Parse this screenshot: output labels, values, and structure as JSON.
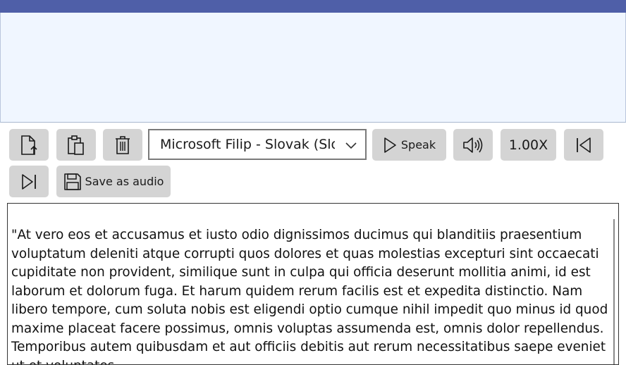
{
  "window": {
    "titlebar_color": "#4f5fa8",
    "panel_color": "#f0f6ff"
  },
  "toolbar": {
    "open_icon": "open-file-icon",
    "paste_icon": "paste-icon",
    "clear_icon": "trash-icon",
    "voice_selected": "Microsoft Filip - Slovak (Slovakia)",
    "speak_label": "Speak",
    "volume_icon": "volume-icon",
    "rate_label": "1.00X",
    "previous_icon": "skip-back-icon",
    "next_icon": "skip-forward-icon",
    "save_audio_label": "Save as audio"
  },
  "editor": {
    "text": "\"At vero eos et accusamus et iusto odio dignissimos ducimus qui blanditiis praesentium voluptatum deleniti atque corrupti quos dolores et quas molestias excepturi sint occaecati cupiditate non provident, similique sunt in culpa qui officia deserunt mollitia animi, id est laborum et dolorum fuga. Et harum quidem rerum facilis est et expedita distinctio. Nam libero tempore, cum soluta nobis est eligendi optio cumque nihil impedit quo minus id quod maxime placeat facere possimus, omnis voluptas assumenda est, omnis dolor repellendus. Temporibus autem quibusdam et aut officiis debitis aut rerum necessitatibus saepe eveniet ut et voluptates"
  }
}
